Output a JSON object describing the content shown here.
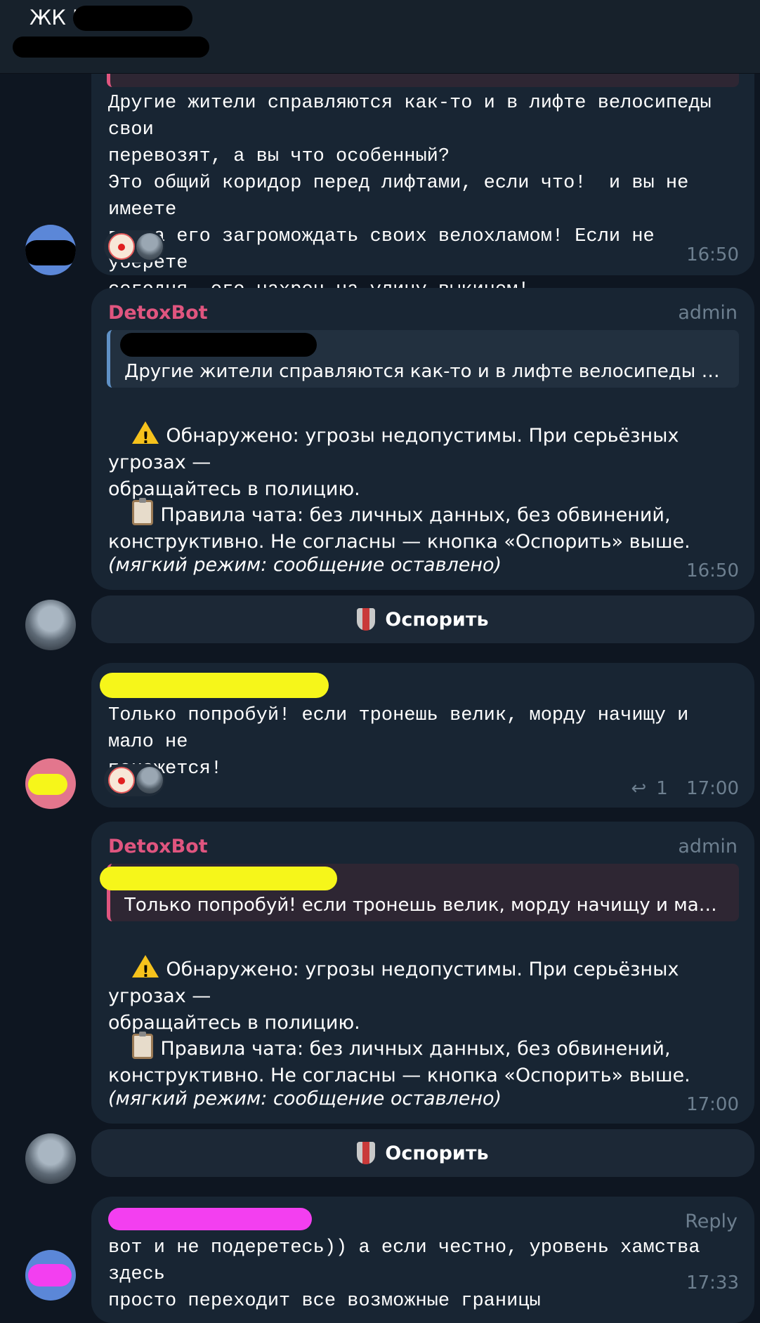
{
  "header": {
    "chat_title": "ЖК \"                    \""
  },
  "messages": [
    {
      "text": "Другие жители справляются как-то и в лифте велосипеды свои\nперевозят, а вы что особенный?\nЭто общий коридор перед лифтами, если что!  и вы не имеете\nправа его загромождать своих велохламом! Если не уберете\nсегодня, его нахрен на улицу выкинем!",
      "time": "16:50",
      "reactions": [
        "clown-icon",
        "robot-icon"
      ]
    },
    {
      "sender": "DetoxBot",
      "role": "admin",
      "quote": "Другие жители справляются как-то и в лифте велосипеды св...",
      "warning": "Обнаружено: угрозы недопустимы. При серьёзных угрозах —\nобращайтесь в полицию.",
      "rules": "Правила чата: без личных данных, без обвинений,\nконструктивно. Не согласны — кнопка «Оспорить» выше.",
      "mode": "(мягкий режим: сообщение оставлено)",
      "time": "16:50",
      "button": "Оспорить"
    },
    {
      "text": "Только попробуй! если тронешь велик, морду начищу и мало не\nпокажется!",
      "reply_count": "1",
      "time": "17:00",
      "reactions": [
        "clown-icon",
        "robot-icon"
      ]
    },
    {
      "sender": "DetoxBot",
      "role": "admin",
      "quote": "Только попробуй! если тронешь велик, морду начищу и мал...",
      "warning": "Обнаружено: угрозы недопустимы. При серьёзных угрозах —\nобращайтесь в полицию.",
      "rules": "Правила чата: без личных данных, без обвинений,\nконструктивно. Не согласны — кнопка «Оспорить» выше.",
      "mode": "(мягкий режим: сообщение оставлено)",
      "time": "17:00",
      "button": "Оспорить"
    },
    {
      "reply_label": "Reply",
      "text": "вот и не подеретесь)) а если честно, уровень хамства здесь\nпросто переходит все возможные границы",
      "time": "17:33"
    }
  ],
  "colors": {
    "background": "#0e1621",
    "bubble": "#182533",
    "sender": "#e0557f",
    "meta": "#6d7f8f",
    "redact_black": "#000000",
    "redact_yellow": "#f6f61a",
    "redact_magenta": "#f33ff0"
  }
}
